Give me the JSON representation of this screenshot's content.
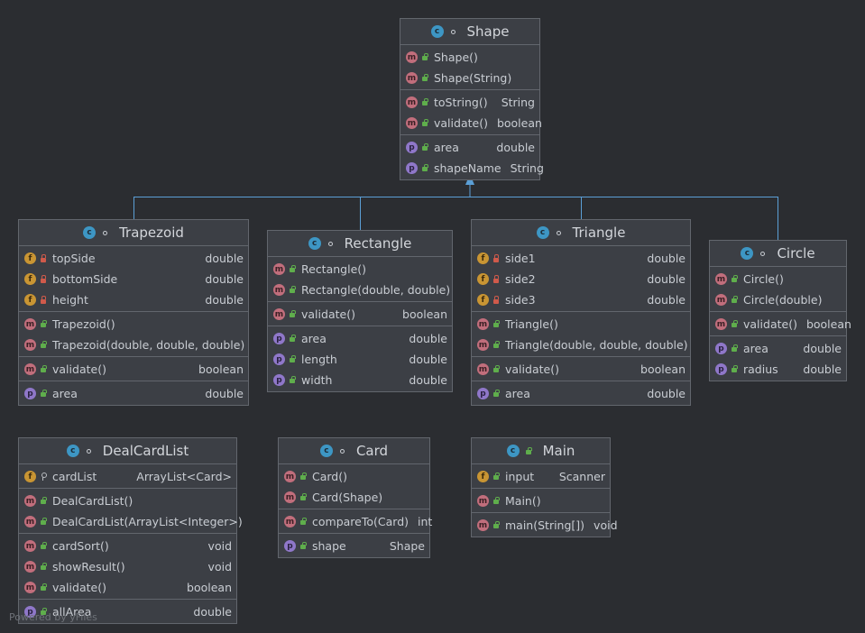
{
  "diagram": {
    "footer": "Powered by yFiles",
    "classes": [
      {
        "id": "shape",
        "title": "Shape",
        "header_icons": [
          "class-icon",
          "static-icon"
        ],
        "sections": [
          [
            {
              "kind": "m",
              "vis": "pub",
              "name": "Shape()",
              "type": ""
            },
            {
              "kind": "m",
              "vis": "pub",
              "name": "Shape(String)",
              "type": ""
            }
          ],
          [
            {
              "kind": "m",
              "vis": "pub",
              "name": "toString()",
              "type": "String"
            },
            {
              "kind": "m",
              "vis": "pub",
              "name": "validate()",
              "type": "boolean"
            }
          ],
          [
            {
              "kind": "p",
              "vis": "pub",
              "name": "area",
              "type": "double"
            },
            {
              "kind": "p",
              "vis": "pub",
              "name": "shapeName",
              "type": "String"
            }
          ]
        ]
      },
      {
        "id": "trapezoid",
        "title": "Trapezoid",
        "header_icons": [
          "class-icon",
          "static-icon"
        ],
        "sections": [
          [
            {
              "kind": "f",
              "vis": "priv",
              "name": "topSide",
              "type": "double"
            },
            {
              "kind": "f",
              "vis": "priv",
              "name": "bottomSide",
              "type": "double"
            },
            {
              "kind": "f",
              "vis": "priv",
              "name": "height",
              "type": "double"
            }
          ],
          [
            {
              "kind": "m",
              "vis": "pub",
              "name": "Trapezoid()",
              "type": ""
            },
            {
              "kind": "m",
              "vis": "pub",
              "name": "Trapezoid(double, double, double)",
              "type": ""
            }
          ],
          [
            {
              "kind": "m",
              "vis": "pub",
              "name": "validate()",
              "type": "boolean"
            }
          ],
          [
            {
              "kind": "p",
              "vis": "pub",
              "name": "area",
              "type": "double"
            }
          ]
        ]
      },
      {
        "id": "rectangle",
        "title": "Rectangle",
        "header_icons": [
          "class-icon",
          "static-icon"
        ],
        "sections": [
          [
            {
              "kind": "m",
              "vis": "pub",
              "name": "Rectangle()",
              "type": ""
            },
            {
              "kind": "m",
              "vis": "pub",
              "name": "Rectangle(double, double)",
              "type": ""
            }
          ],
          [
            {
              "kind": "m",
              "vis": "pub",
              "name": "validate()",
              "type": "boolean"
            }
          ],
          [
            {
              "kind": "p",
              "vis": "pub",
              "name": "area",
              "type": "double"
            },
            {
              "kind": "p",
              "vis": "pub",
              "name": "length",
              "type": "double"
            },
            {
              "kind": "p",
              "vis": "pub",
              "name": "width",
              "type": "double"
            }
          ]
        ]
      },
      {
        "id": "triangle",
        "title": "Triangle",
        "header_icons": [
          "class-icon",
          "static-icon"
        ],
        "sections": [
          [
            {
              "kind": "f",
              "vis": "priv",
              "name": "side1",
              "type": "double"
            },
            {
              "kind": "f",
              "vis": "priv",
              "name": "side2",
              "type": "double"
            },
            {
              "kind": "f",
              "vis": "priv",
              "name": "side3",
              "type": "double"
            }
          ],
          [
            {
              "kind": "m",
              "vis": "pub",
              "name": "Triangle()",
              "type": ""
            },
            {
              "kind": "m",
              "vis": "pub",
              "name": "Triangle(double, double, double)",
              "type": ""
            }
          ],
          [
            {
              "kind": "m",
              "vis": "pub",
              "name": "validate()",
              "type": "boolean"
            }
          ],
          [
            {
              "kind": "p",
              "vis": "pub",
              "name": "area",
              "type": "double"
            }
          ]
        ]
      },
      {
        "id": "circle",
        "title": "Circle",
        "header_icons": [
          "class-icon",
          "static-icon"
        ],
        "sections": [
          [
            {
              "kind": "m",
              "vis": "pub",
              "name": "Circle()",
              "type": ""
            },
            {
              "kind": "m",
              "vis": "pub",
              "name": "Circle(double)",
              "type": ""
            }
          ],
          [
            {
              "kind": "m",
              "vis": "pub",
              "name": "validate()",
              "type": "boolean"
            }
          ],
          [
            {
              "kind": "p",
              "vis": "pub",
              "name": "area",
              "type": "double"
            },
            {
              "kind": "p",
              "vis": "pub",
              "name": "radius",
              "type": "double"
            }
          ]
        ]
      },
      {
        "id": "dealcardlist",
        "title": "DealCardList",
        "header_icons": [
          "class-icon",
          "static-icon"
        ],
        "sections": [
          [
            {
              "kind": "f",
              "vis": "pkg",
              "name": "cardList",
              "type": "ArrayList<Card>"
            }
          ],
          [
            {
              "kind": "m",
              "vis": "pub",
              "name": "DealCardList()",
              "type": ""
            },
            {
              "kind": "m",
              "vis": "pub",
              "name": "DealCardList(ArrayList<Integer>)",
              "type": ""
            }
          ],
          [
            {
              "kind": "m",
              "vis": "pub",
              "name": "cardSort()",
              "type": "void"
            },
            {
              "kind": "m",
              "vis": "pub",
              "name": "showResult()",
              "type": "void"
            },
            {
              "kind": "m",
              "vis": "pub",
              "name": "validate()",
              "type": "boolean"
            }
          ],
          [
            {
              "kind": "p",
              "vis": "pub",
              "name": "allArea",
              "type": "double"
            }
          ]
        ]
      },
      {
        "id": "card",
        "title": "Card",
        "header_icons": [
          "class-icon",
          "static-icon"
        ],
        "sections": [
          [
            {
              "kind": "m",
              "vis": "pub",
              "name": "Card()",
              "type": ""
            },
            {
              "kind": "m",
              "vis": "pub",
              "name": "Card(Shape)",
              "type": ""
            }
          ],
          [
            {
              "kind": "m",
              "vis": "pub",
              "name": "compareTo(Card)",
              "type": "int"
            }
          ],
          [
            {
              "kind": "p",
              "vis": "pub",
              "name": "shape",
              "type": "Shape"
            }
          ]
        ]
      },
      {
        "id": "main",
        "title": "Main",
        "header_icons": [
          "class-icon",
          "public-icon"
        ],
        "sections": [
          [
            {
              "kind": "f",
              "vis": "pub",
              "name": "input",
              "type": "Scanner"
            }
          ],
          [
            {
              "kind": "m",
              "vis": "pub",
              "name": "Main()",
              "type": ""
            }
          ],
          [
            {
              "kind": "m",
              "vis": "pub",
              "name": "main(String[])",
              "type": "void"
            }
          ]
        ]
      }
    ]
  },
  "colors": {
    "background": "#2b2d31",
    "box": "#3c3f45",
    "border": "#62666d",
    "edge": "#5b9fd6",
    "class_icon": "#3d96c4",
    "method_icon": "#c16e7c",
    "field_icon": "#c99533",
    "property_icon": "#8f77c9"
  }
}
